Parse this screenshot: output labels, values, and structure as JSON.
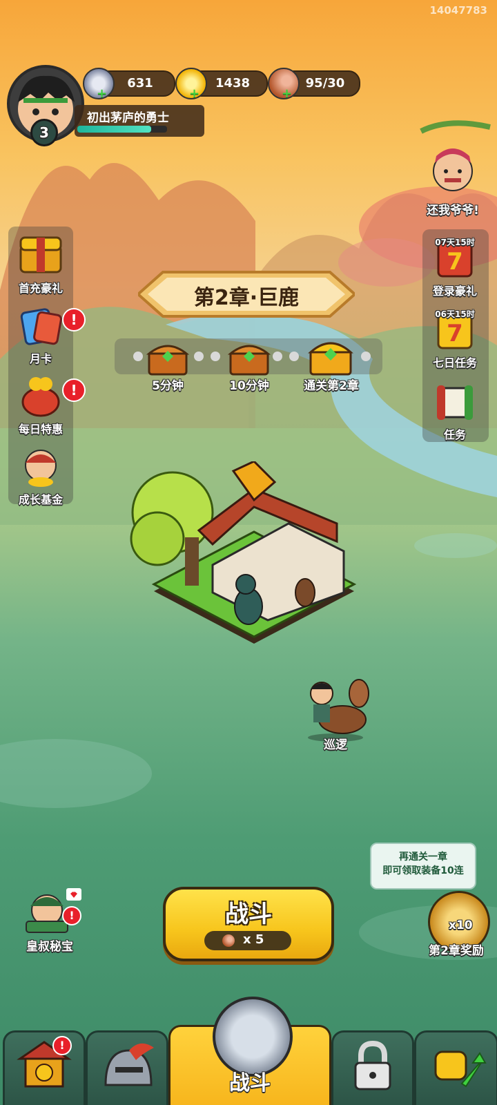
{
  "build_id": "14047783",
  "player": {
    "level": "3",
    "title": "初出茅庐的勇士",
    "exp_fraction": 0.82
  },
  "resources": [
    {
      "icon": "silver-coin-icon",
      "value": "631"
    },
    {
      "icon": "gold-ingot-icon",
      "value": "1438"
    },
    {
      "icon": "meat-stamina-icon",
      "value": "95/30"
    }
  ],
  "event_top_right": {
    "label": "还我爷爷!"
  },
  "left_menu": [
    {
      "label": "首充豪礼",
      "icon": "gift-chest-icon",
      "badge": ""
    },
    {
      "label": "月卡",
      "icon": "month-card-icon",
      "badge": "!"
    },
    {
      "label": "每日特惠",
      "icon": "money-bag-icon",
      "badge": "!"
    },
    {
      "label": "成长基金",
      "icon": "fund-character-icon",
      "badge": ""
    }
  ],
  "right_menu": [
    {
      "label": "登录豪礼",
      "timer": "07天15时",
      "icon": "login-gift-7-icon"
    },
    {
      "label": "七日任务",
      "timer": "06天15时",
      "icon": "seven-day-task-icon"
    },
    {
      "label": "任务",
      "timer": "",
      "icon": "task-scroll-icon"
    }
  ],
  "chapter": {
    "title": "第2章·巨鹿",
    "chests": [
      {
        "label": "5分钟"
      },
      {
        "label": "10分钟"
      },
      {
        "label": "通关第2章"
      }
    ]
  },
  "patrol": {
    "label": "巡逻"
  },
  "bottom_left": {
    "label": "皇叔秘宝",
    "badge": "!"
  },
  "battle_button": {
    "label": "战斗",
    "cost": "x 5"
  },
  "chapter_reward": {
    "tooltip_line1": "再通关一章",
    "tooltip_line2": "即可领取装备10连",
    "count": "x10",
    "label": "第2章奖励"
  },
  "nav": {
    "center_label": "战斗",
    "shop_badge": "!"
  },
  "colors": {
    "accent_yellow": "#f7c51c",
    "badge_red": "#e8202a",
    "nav_green": "#2c5446"
  }
}
